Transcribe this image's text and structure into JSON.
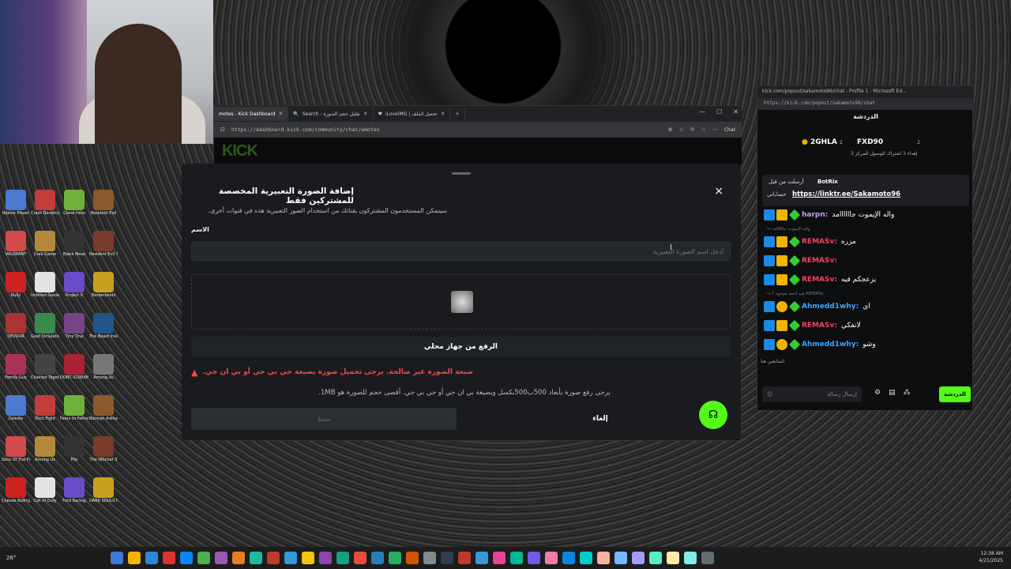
{
  "browser": {
    "tabs": [
      {
        "label": "motes - Kick Dashboard",
        "active": true
      },
      {
        "label": "Search - تقليل حجم الصورة",
        "active": false
      },
      {
        "label": "iLovelMG | تحميل الملف",
        "active": false
      }
    ],
    "new_tab": "+",
    "url": "https://dashboard.kick.com/community/chat/emotes",
    "chat_button": "Chat",
    "logo": "KICK"
  },
  "modal": {
    "title": "إضافة الصورة التعبيرية المخصصة للمشتركين فقط",
    "subtitle": "سيتمكن المستخدمون المشتركون بقناتك من استخدام الصور التعبيرية هذه في قنوات أخرى.",
    "name_label": "الاسم",
    "name_placeholder": "أدخل اسم الصورة التعبيرية",
    "upload_label": "الرفع من جهاز محلي",
    "error": "صيغة الصورة غير صالحة. يرجى تحميل صورة بصيغة جي بي جي أو بي ان جي.",
    "requirements": "يرجى رفع صورة بأبعاد 500ب500بكسل وبصيغة بي ان جي أو جي بي جي. أقصى حجم للصورة هو 1MB.",
    "save": "حفظ",
    "cancel": "إلغاء",
    "close": "×"
  },
  "chat": {
    "window_title": "kick.com/popout/sakamoto96/chat - Profile 1 - Microsoft Ed...",
    "url": "https://kick.com/popout/sakamoto96/chat",
    "header": "الدردشة",
    "leaderboard": [
      {
        "rank": "1",
        "name": "2GHLA",
        "count": "2"
      },
      {
        "name": "FXD90",
        "count": "2",
        "note": "إهداء 1 اشتراك للوصول للمركز 3"
      }
    ],
    "pinned": {
      "by": "أرسلت من قبل",
      "user": "BotRix",
      "label": "حساباتي",
      "link": "https://linktr.ee/Sakamoto96"
    },
    "messages": [
      {
        "user": "harpn",
        "color": "#c99cf7",
        "text": "واله الإيموت جاااااامد",
        "reply": ""
      },
      {
        "user": "REMASv",
        "color": "#f2435b",
        "text": "مزره",
        "reply": "واله الإيموت جاااااامد"
      },
      {
        "user": "REMASv",
        "color": "#f2435b",
        "text": "",
        "reply": ""
      },
      {
        "user": "REMASv",
        "color": "#f2435b",
        "text": "يزعجكم فيه",
        "reply": ""
      },
      {
        "user": "Ahmedd1why",
        "color": "#3aa8ff",
        "text": "اي",
        "reply": "هيه أحمد موجود ؟ REMASv"
      },
      {
        "user": "REMASv",
        "color": "#f2435b",
        "text": "لاتفكي",
        "reply": ""
      },
      {
        "user": "Ahmedd1why",
        "color": "#3aa8ff",
        "text": "وشو",
        "reply": ""
      }
    ],
    "followers_label": "المتابعين هنا",
    "input_placeholder": "إرسال رسالة",
    "send": "الدردشة"
  },
  "desktop": {
    "icons": [
      "Roblox Player",
      "Crash Bandicoot",
      "Clone Hero",
      "Resident Evil",
      "VALORANT",
      "Crab Game",
      "Black Mesa",
      "Resident Evil 7",
      "Bully",
      "Untitled Goose",
      "Project X",
      "Borderlands",
      "DEVOUR",
      "Goat Simulator",
      "Tiny Tina",
      "The Beast Inside",
      "Family Guy",
      "Chained Together",
      "DONT SCREAM",
      "Among Us",
      "Celeste",
      "Stick Fight",
      "Fears to Fathom",
      "Batman Arkham",
      "Sons Of The Forest",
      "Among Us",
      "Fifa",
      "The Witcher 3",
      "Cheese Rolling",
      "Call of Duty",
      "Ford Racing",
      "DARK SOULS III"
    ]
  },
  "taskbar": {
    "weather": "26°",
    "time": "12:38 AM",
    "date": "4/21/2025"
  }
}
